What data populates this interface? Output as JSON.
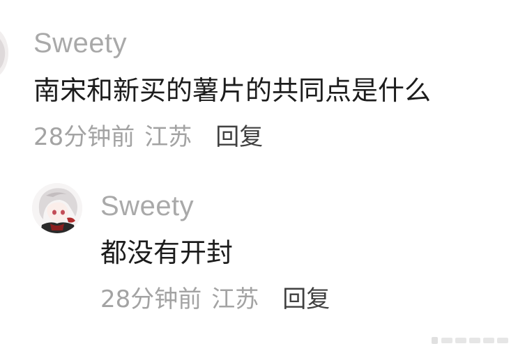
{
  "thread": {
    "main_comment": {
      "username": "Sweety",
      "text": "南宋和新买的薯片的共同点是什么",
      "time": "28分钟前",
      "location": "江苏",
      "reply_label": "回复",
      "avatar_icon": "anime-avatar-icon"
    },
    "reply_comment": {
      "username": "Sweety",
      "text": "都没有开封",
      "time": "28分钟前",
      "location": "江苏",
      "reply_label": "回复",
      "avatar_icon": "anime-avatar-icon"
    }
  },
  "colors": {
    "username": "#a9a9a9",
    "body_text": "#1c1c1c",
    "meta_text": "#a3a3a3",
    "reply_link": "#404040",
    "background": "#ffffff"
  }
}
